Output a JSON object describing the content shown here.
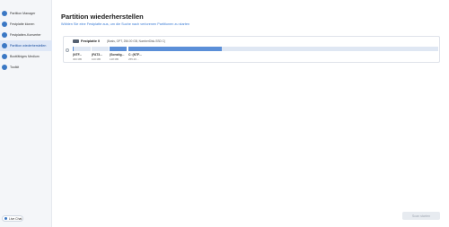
{
  "sidebar": {
    "items": [
      {
        "label": "Partition Manager",
        "active": false
      },
      {
        "label": "Festplatte klonen",
        "active": false
      },
      {
        "label": "Festplatten-Konverter",
        "active": false
      },
      {
        "label": "Partition wiederherstellen",
        "active": true
      },
      {
        "label": "Bootfähiges Medium",
        "active": false
      },
      {
        "label": "Toolkit",
        "active": false
      }
    ],
    "live_chat": "Live Chat"
  },
  "main": {
    "title": "Partition wiederherstellen",
    "subtitle": "Wählen Sie eine Festplatte aus, um die Suche nach verlorenen Partitionen zu starten"
  },
  "disk": {
    "name": "Festplatte 0",
    "info": "(Basis, GPT, 256.00 GB, NumberDisk-SSD C)",
    "partitions": [
      {
        "name": "(NTF...",
        "size": "300 MB",
        "fill": 0.06
      },
      {
        "name": "(FAT3...",
        "size": "100 MB",
        "fill": 0.0
      },
      {
        "name": "(Sonstig...",
        "size": "128 MB",
        "fill": 1.0
      },
      {
        "name": "C: (NTF...",
        "size": "255.29 ...",
        "fill": 0.3
      }
    ]
  },
  "footer": {
    "search_button": "Scan starten"
  },
  "colors": {
    "accent": "#3a7bd5",
    "bar_fill": "#5b8fd8",
    "bar_bg": "#dfe7f3"
  }
}
